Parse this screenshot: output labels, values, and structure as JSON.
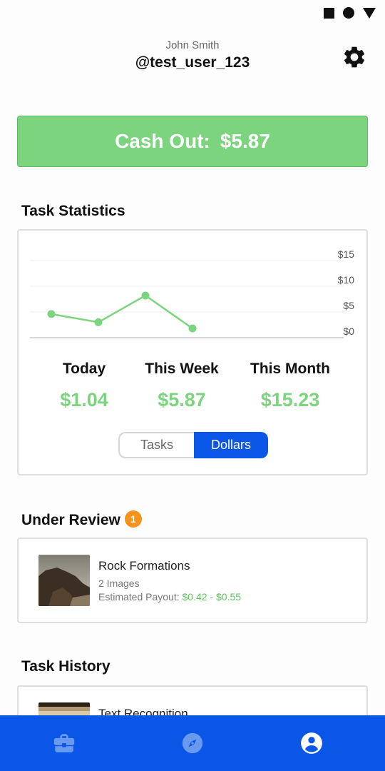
{
  "profile": {
    "name": "John Smith",
    "handle": "@test_user_123"
  },
  "cashout": {
    "label": "Cash Out:",
    "amount": "$5.87"
  },
  "task_statistics": {
    "title": "Task Statistics",
    "stats": [
      {
        "label": "Today",
        "value": "$1.04"
      },
      {
        "label": "This Week",
        "value": "$5.87"
      },
      {
        "label": "This Month",
        "value": "$15.23"
      }
    ],
    "toggle": {
      "options": [
        "Tasks",
        "Dollars"
      ],
      "selected": "Dollars"
    }
  },
  "chart_data": {
    "type": "line",
    "title": "",
    "xlabel": "",
    "ylabel": "",
    "ylim": [
      0,
      15
    ],
    "ytick_labels": [
      "$15",
      "$10",
      "$5",
      "$0"
    ],
    "yticks": [
      15,
      10,
      5,
      0
    ],
    "x": [
      1,
      2,
      3,
      4
    ],
    "values": [
      4.6,
      3.0,
      8.2,
      1.8
    ],
    "grid": true,
    "color": "#7dd47f"
  },
  "under_review": {
    "title": "Under Review",
    "badge_count": "1",
    "item": {
      "title": "Rock Formations",
      "count": "2 Images",
      "payout_label": "Estimated Payout:",
      "payout_range": "$0.42 - $0.55"
    }
  },
  "task_history": {
    "title": "Task History",
    "first_item_title": "Text Recognition"
  },
  "bottom_nav": {
    "items": [
      "briefcase-icon",
      "compass-icon",
      "account-circle-icon"
    ],
    "active": "account-circle-icon"
  },
  "colors": {
    "accent_green": "#7dd47f",
    "primary_blue": "#0a56e6",
    "badge_orange": "#f6931d"
  }
}
